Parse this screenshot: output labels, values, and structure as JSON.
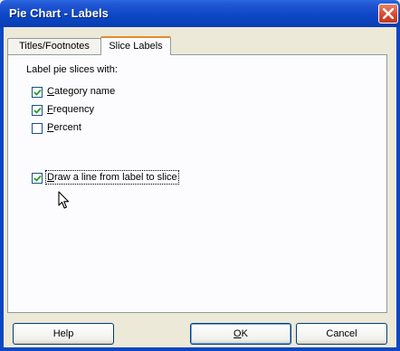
{
  "window": {
    "title": "Pie Chart - Labels"
  },
  "tabs": [
    {
      "label": "Titles/Footnotes",
      "active": false
    },
    {
      "label": "Slice Labels",
      "active": true
    }
  ],
  "panel": {
    "group_label": "Label pie slices with:",
    "options": {
      "category_name": {
        "accel": "C",
        "rest": "ategory name",
        "checked": true
      },
      "frequency": {
        "accel": "F",
        "rest": "requency",
        "checked": true
      },
      "percent": {
        "accel": "P",
        "rest": "ercent",
        "checked": false
      },
      "draw_line": {
        "accel": "D",
        "rest": "raw a line from label to slice",
        "checked": true
      }
    }
  },
  "buttons": {
    "help": "Help",
    "ok_accel": "O",
    "ok_rest": "K",
    "cancel": "Cancel"
  },
  "colors": {
    "titlebar": "#0b46c4",
    "dialog_bg": "#ece9d8",
    "panel_bg": "#fcfcfe",
    "tab_highlight": "#e68b2c",
    "close_button": "#d6452b"
  },
  "icons": {
    "close": "close-icon",
    "check": "checkmark-icon",
    "cursor": "mouse-pointer-icon"
  }
}
